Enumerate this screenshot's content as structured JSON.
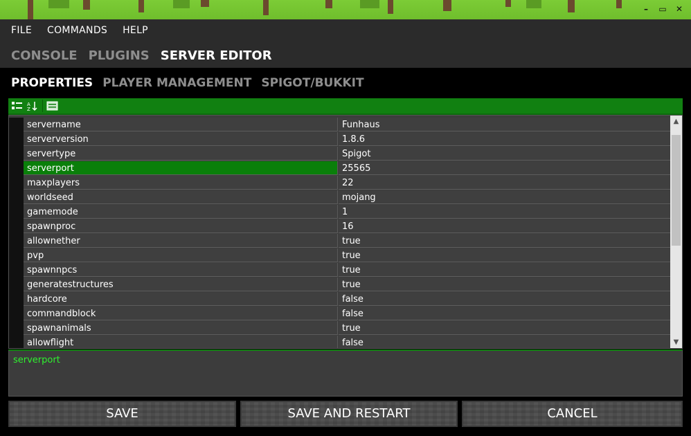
{
  "window": {
    "minimize": "–",
    "maximize": "▭",
    "close": "✕"
  },
  "menu": {
    "file": "FILE",
    "commands": "COMMANDS",
    "help": "HELP"
  },
  "tabs": {
    "console": "CONSOLE",
    "plugins": "PLUGINS",
    "server_editor": "SERVER EDITOR"
  },
  "subtabs": {
    "properties": "PROPERTIES",
    "player_management": "PLAYER MANAGEMENT",
    "spigot_bukkit": "SPIGOT/BUKKIT"
  },
  "properties": [
    {
      "key": "servername",
      "value": "Funhaus"
    },
    {
      "key": "serverversion",
      "value": "1.8.6"
    },
    {
      "key": "servertype",
      "value": "Spigot"
    },
    {
      "key": "serverport",
      "value": "25565",
      "selected": true
    },
    {
      "key": "maxplayers",
      "value": "22"
    },
    {
      "key": "worldseed",
      "value": "mojang"
    },
    {
      "key": "gamemode",
      "value": "1"
    },
    {
      "key": "spawnproc",
      "value": "16"
    },
    {
      "key": "allownether",
      "value": "true"
    },
    {
      "key": "pvp",
      "value": "true"
    },
    {
      "key": "spawnnpcs",
      "value": "true"
    },
    {
      "key": "generatestructures",
      "value": "true"
    },
    {
      "key": "hardcore",
      "value": "false"
    },
    {
      "key": "commandblock",
      "value": "false"
    },
    {
      "key": "spawnanimals",
      "value": "true"
    },
    {
      "key": "allowflight",
      "value": "false"
    }
  ],
  "description": "serverport",
  "buttons": {
    "save": "SAVE",
    "save_restart": "SAVE AND RESTART",
    "cancel": "CANCEL"
  },
  "colors": {
    "accent_green": "#118011",
    "selected_row": "#0a7f0a",
    "desc_text": "#2ef22e"
  }
}
